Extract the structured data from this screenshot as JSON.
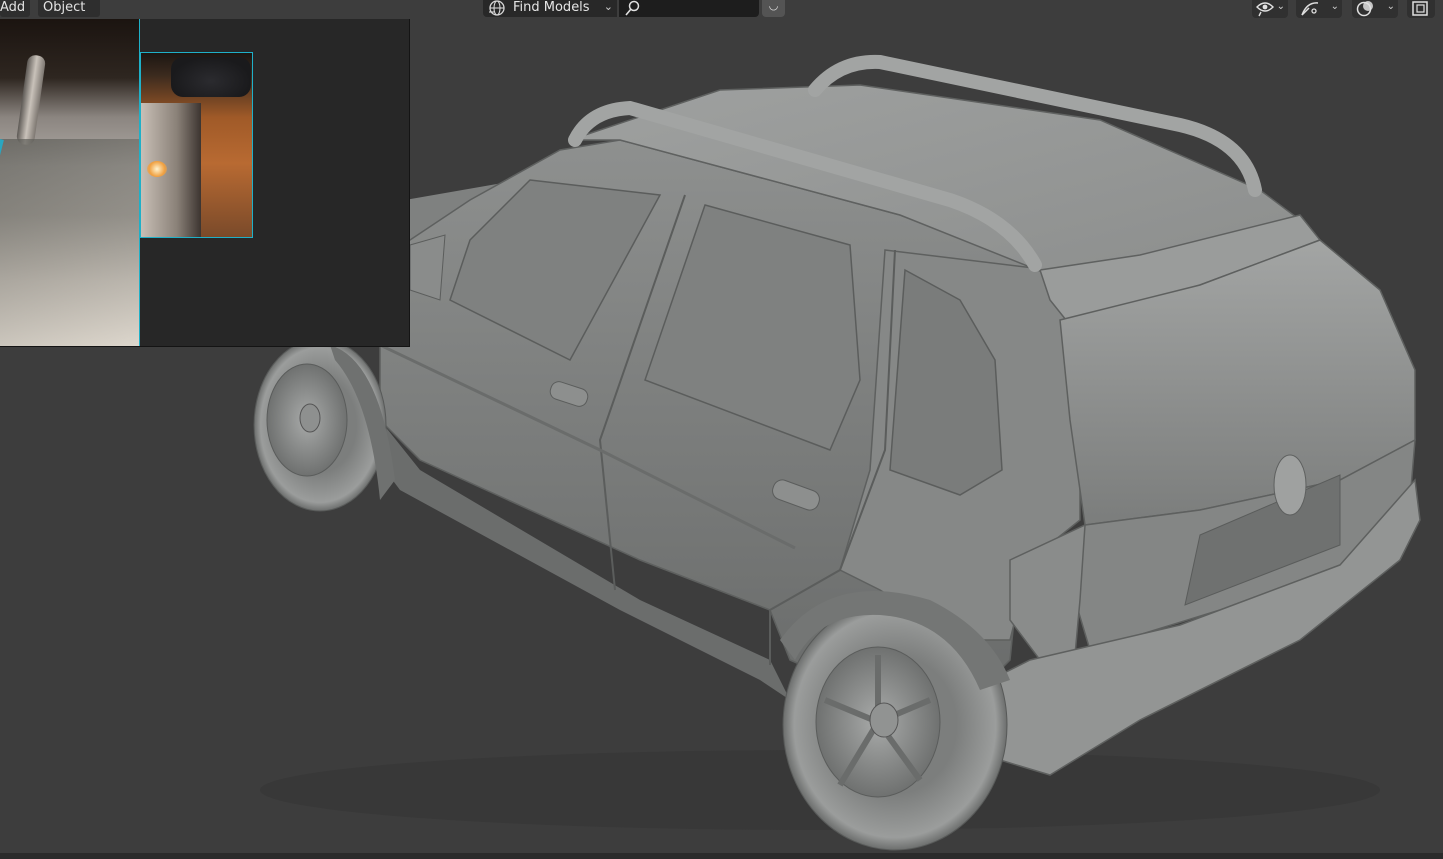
{
  "header": {
    "menus": [
      {
        "label": "Add"
      },
      {
        "label": "Object"
      }
    ],
    "find_models": {
      "label": "Find Models",
      "icon": "globe-icon",
      "dropdown_icon": "chevron-down-icon"
    },
    "search": {
      "icon": "search-icon",
      "value": ""
    },
    "right_tools": [
      {
        "icon": "visibility-icon"
      },
      {
        "icon": "gizmo-icon"
      },
      {
        "icon": "overlays-icon"
      },
      {
        "icon": "xray-toggle-icon"
      }
    ]
  },
  "reference_panel": {
    "images": [
      {
        "subject": "car roof rail photo"
      },
      {
        "subject": "street at night photo"
      }
    ]
  },
  "viewport": {
    "subject": "3D hatchback car model",
    "shading": "solid gray"
  },
  "colors": {
    "background": "#3d3d3d",
    "header": "#2e2e2e",
    "accent": "#1fb0c8",
    "model": "#8f9190"
  }
}
